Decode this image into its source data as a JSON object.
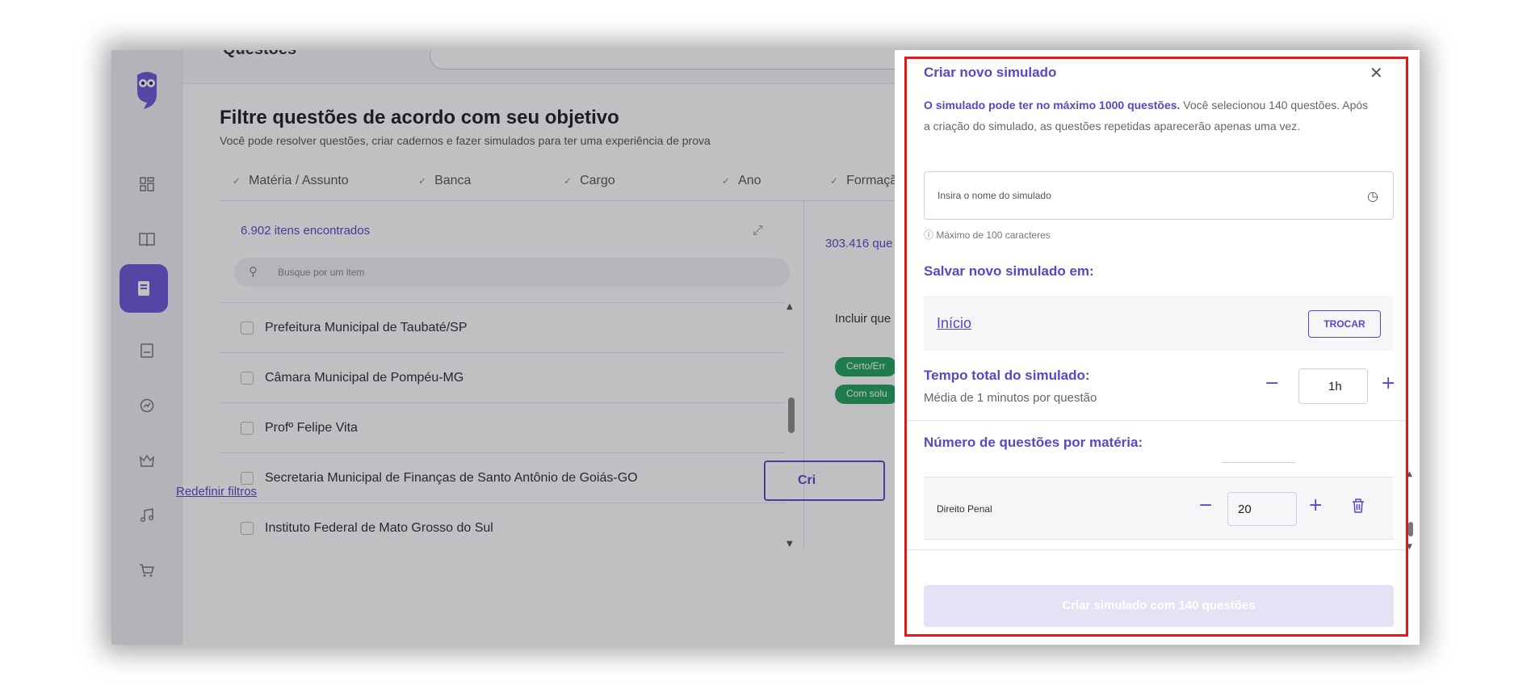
{
  "topbar": {
    "title": "Questões"
  },
  "page": {
    "title": "Filtre questões de acordo com seu objetivo",
    "subtitle": "Você pode resolver questões, criar cadernos e fazer simulados para ter uma experiência de prova"
  },
  "filter_tabs": [
    "Matéria / Assunto",
    "Banca",
    "Cargo",
    "Ano",
    "Formaçã"
  ],
  "left_panel": {
    "count": "6.902 itens encontrados",
    "search_placeholder": "Busque por um item",
    "items": [
      "Prefeitura Municipal de Taubaté/SP",
      "Câmara Municipal de Pompéu-MG",
      "Profº Felipe Vita",
      "Secretaria Municipal de Finanças de Santo Antônio de Goiás-GO",
      "Instituto Federal de Mato Grosso do Sul"
    ],
    "reset_link": "Redefinir filtros"
  },
  "middle_panel": {
    "count": "303.416 que",
    "include_label": "Incluir que",
    "pills": [
      "Certo/Err",
      "Com solu"
    ],
    "create_button": "Cri"
  },
  "drawer": {
    "title": "Criar novo simulado",
    "info_bold": "O simulado pode ter no máximo 1000 questões.",
    "info_rest": " Você selecionou 140 questões. Após a criação do simulado, as questões repetidas aparecerão apenas uma vez.",
    "name_placeholder": "Insira o nome do simulado",
    "name_hint": "Máximo de 100 caracteres",
    "save_heading": "Salvar novo simulado em:",
    "folder_name": "Início",
    "change_button": "TROCAR",
    "time_heading": "Tempo total do simulado:",
    "time_sub": "Média de 1 minutos por questão",
    "time_value": "1h",
    "subjects_heading": "Número de questões por matéria:",
    "subjects": [
      {
        "name": "Direito Penal",
        "count": "20"
      }
    ],
    "create_button": "Criar simulado com 140 questões"
  },
  "colors": {
    "accent": "#5b46c7",
    "sidebar_active": "#6b57d6",
    "highlight_border": "#e11919",
    "pill_green": "#21a05a"
  },
  "icons": {
    "sidebar": [
      "dashboard-icon",
      "book-icon",
      "notebook-icon",
      "file-icon",
      "chart-icon",
      "crown-icon",
      "music-icon",
      "cart-icon"
    ]
  }
}
